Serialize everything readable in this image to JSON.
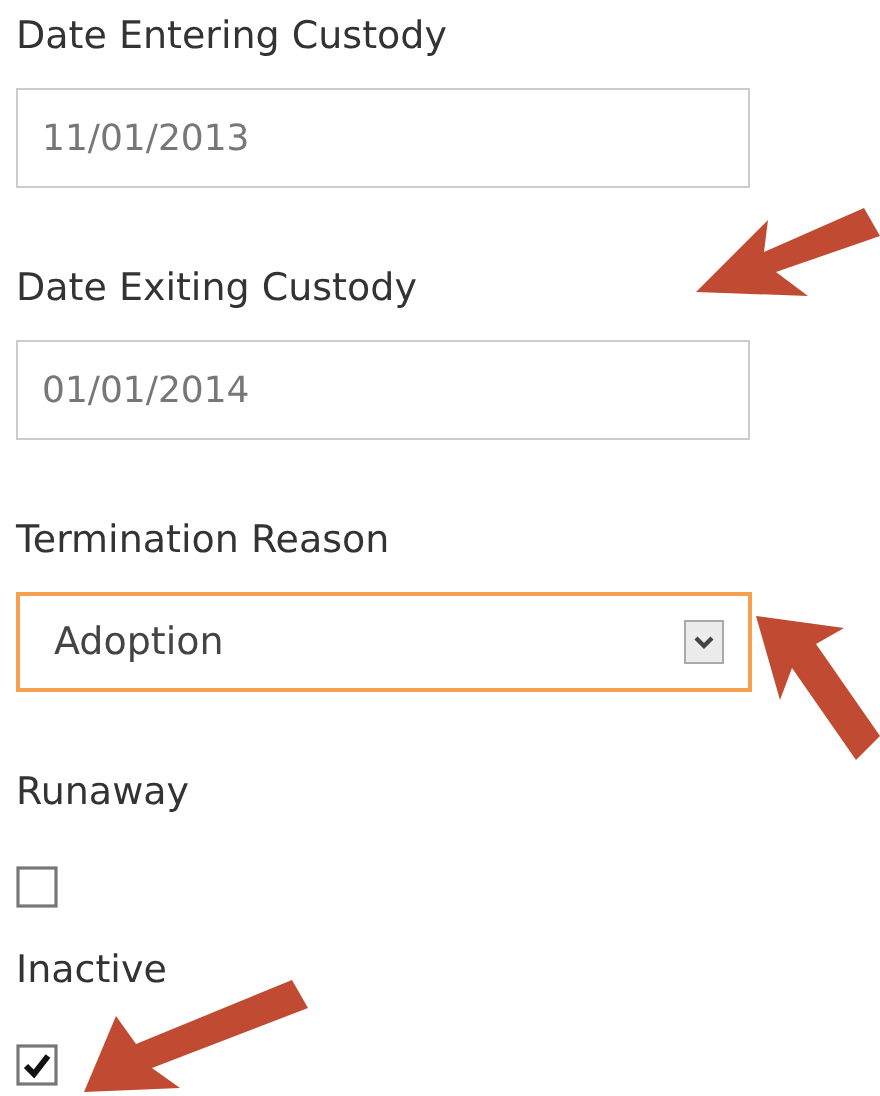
{
  "fields": [
    {
      "kind": "text",
      "label": "Date Entering Custody",
      "value": "11/01/2013"
    },
    {
      "kind": "text",
      "label": "Date Exiting Custody",
      "value": "01/01/2014"
    },
    {
      "kind": "select",
      "label": "Termination Reason",
      "value": "Adoption",
      "focused": true
    },
    {
      "kind": "checkbox",
      "label": "Runaway",
      "checked": false
    },
    {
      "kind": "checkbox",
      "label": "Inactive",
      "checked": true
    }
  ]
}
